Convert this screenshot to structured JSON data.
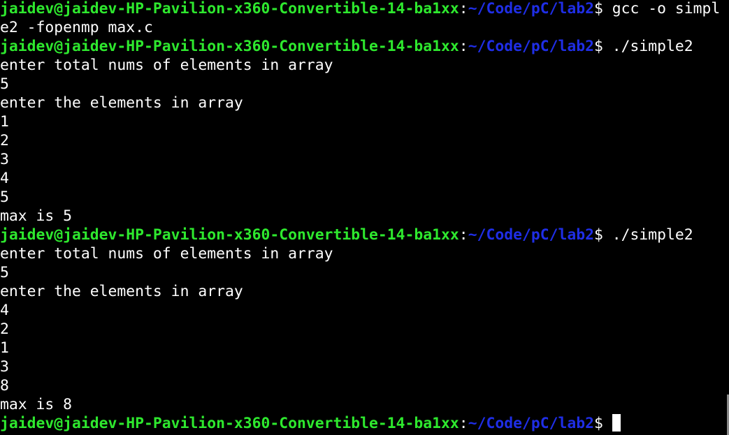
{
  "terminal": {
    "colors": {
      "background": "#000000",
      "user_host": "#2ee82e",
      "path": "#1f2ee6",
      "text": "#ffffff"
    },
    "prompt": {
      "user_host": "jaidev@jaidev-HP-Pavilion-x360-Convertible-14-ba1xx",
      "separator": ":",
      "path": "~/Code/pC/lab2",
      "symbol": "$"
    },
    "lines": [
      {
        "type": "prompt",
        "command": " gcc -o simpl"
      },
      {
        "type": "output",
        "text": "e2 -fopenmp max.c"
      },
      {
        "type": "prompt",
        "command": " ./simple2"
      },
      {
        "type": "output",
        "text": "enter total nums of elements in array"
      },
      {
        "type": "output",
        "text": "5"
      },
      {
        "type": "output",
        "text": "enter the elements in array"
      },
      {
        "type": "output",
        "text": "1"
      },
      {
        "type": "output",
        "text": "2"
      },
      {
        "type": "output",
        "text": "3"
      },
      {
        "type": "output",
        "text": "4"
      },
      {
        "type": "output",
        "text": "5"
      },
      {
        "type": "output",
        "text": "max is 5"
      },
      {
        "type": "prompt",
        "command": " ./simple2"
      },
      {
        "type": "output",
        "text": "enter total nums of elements in array"
      },
      {
        "type": "output",
        "text": "5"
      },
      {
        "type": "output",
        "text": "enter the elements in array"
      },
      {
        "type": "output",
        "text": "4"
      },
      {
        "type": "output",
        "text": "2"
      },
      {
        "type": "output",
        "text": "1"
      },
      {
        "type": "output",
        "text": "3"
      },
      {
        "type": "output",
        "text": "8"
      },
      {
        "type": "output",
        "text": "max is 8"
      },
      {
        "type": "prompt",
        "command": " ",
        "cursor": true
      }
    ]
  }
}
